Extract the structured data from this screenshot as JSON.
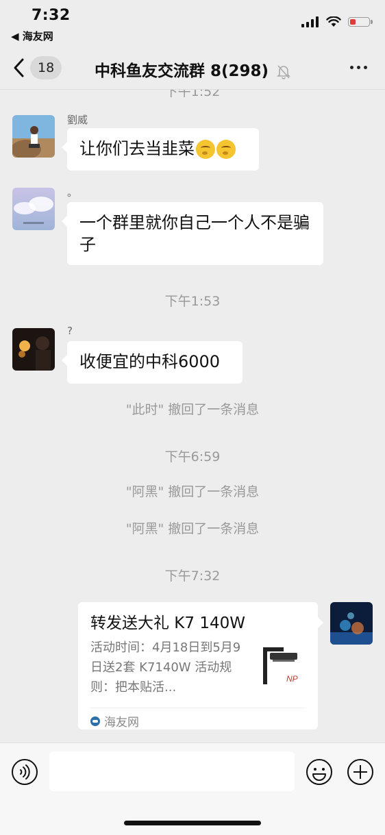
{
  "status_bar": {
    "time": "7:32",
    "back_app": "◀ 海友网"
  },
  "nav": {
    "unread_count": "18",
    "title": "中科鱼友交流群 8(298)"
  },
  "chat": {
    "partial_timestamp": "下午1:52",
    "messages": [
      {
        "sender": "劉威",
        "text": "让你们去当韭菜"
      },
      {
        "sender": "。",
        "text": "一个群里就你自己一个人不是骗子"
      }
    ],
    "timestamp_1": "下午1:53",
    "message_3": {
      "sender": "?",
      "text": "收便宜的中科6000"
    },
    "recall_1": "\"此时\" 撤回了一条消息",
    "timestamp_2": "下午6:59",
    "recall_2": "\"阿黑\" 撤回了一条消息",
    "recall_3": "\"阿黑\" 撤回了一条消息",
    "timestamp_3": "下午7:32",
    "link_card": {
      "title": "转发送大礼 K7 140W",
      "description": "活动时间：4月18日到5月9日送2套 K7140W 活动规则：把本贴活...",
      "source": "海友网",
      "thumb_brand": "NP"
    }
  },
  "colors": {
    "accent_battery_low": "#e23a3a",
    "background": "#ededed",
    "bubble": "#ffffff"
  }
}
